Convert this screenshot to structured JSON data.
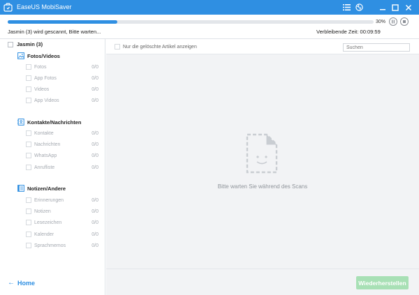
{
  "window": {
    "title": "EaseUS MobiSaver",
    "accent_color": "#2f8fe2"
  },
  "titlebar": {
    "icons": [
      "list-icon",
      "globe-icon",
      "minimize-icon",
      "maximize-icon",
      "close-icon"
    ]
  },
  "scan": {
    "progress_percent": 30,
    "percent_label": "30%",
    "status_text": "Jasmin (3) wird gescannt, Bitte warten...",
    "remaining_text": "Verbleibende Zeit: 00:09:59"
  },
  "sidebar": {
    "device_label": "Jasmin (3)",
    "categories": [
      {
        "label": "Fotos/Videos",
        "icon": "image-icon",
        "items": [
          {
            "label": "Fotos",
            "count": "0/0"
          },
          {
            "label": "App Fotos",
            "count": "0/0"
          },
          {
            "label": "Videos",
            "count": "0/0"
          },
          {
            "label": "App Videos",
            "count": "0/0"
          }
        ]
      },
      {
        "label": "Kontakte/Nachrichten",
        "icon": "contacts-icon",
        "items": [
          {
            "label": "Kontakte",
            "count": "0/0"
          },
          {
            "label": "Nachrichten",
            "count": "0/0"
          },
          {
            "label": "WhatsApp",
            "count": "0/0"
          },
          {
            "label": "Anrufliste",
            "count": "0/0"
          }
        ]
      },
      {
        "label": "Notizen/Andere",
        "icon": "notes-icon",
        "items": [
          {
            "label": "Erinnerungen",
            "count": "0/0"
          },
          {
            "label": "Notizen",
            "count": "0/0"
          },
          {
            "label": "Lesezeichen",
            "count": "0/0"
          },
          {
            "label": "Kalender",
            "count": "0/0"
          },
          {
            "label": "Sprachmemos",
            "count": "0/0"
          }
        ]
      }
    ],
    "home_label": "Home"
  },
  "main": {
    "filter_label": "Nur die gelöschte Artikel anzeigen",
    "search_placeholder": "Suchen",
    "empty_text": "Bitte warten Sie während des Scans",
    "restore_label": "Wiederherstellen",
    "restore_color": "#a8e0b5"
  }
}
